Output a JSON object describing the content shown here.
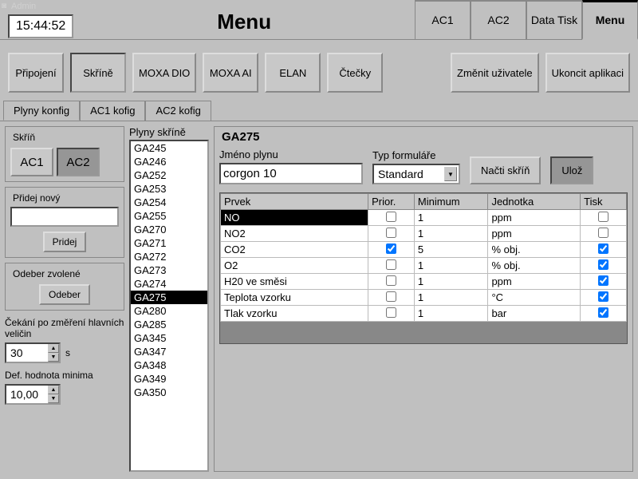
{
  "header": {
    "admin_label": "Admin",
    "time": "15:44:52",
    "title": "Menu",
    "tabs": [
      "AC1",
      "AC2",
      "Data Tisk",
      "Menu"
    ]
  },
  "toolbar": {
    "buttons": [
      "Připojení",
      "Skříně",
      "MOXA DIO",
      "MOXA AI",
      "ELAN",
      "Čtečky"
    ],
    "change_user": "Změnit uživatele",
    "exit_app": "Ukoncit aplikaci"
  },
  "tabs": {
    "items": [
      "Plyny konfig",
      "AC1 kofig",
      "AC2 kofig"
    ]
  },
  "left": {
    "skrin_label": "Skříň",
    "ac1": "AC1",
    "ac2": "AC2",
    "pridej_novy_label": "Přidej nový",
    "pridej_value": "",
    "pridej_btn": "Pridej",
    "odeber_label": "Odeber zvolené",
    "odeber_btn": "Odeber",
    "cekani_label": "Čekání po změření hlavních veličin",
    "cekani_val": "30",
    "cekani_unit": "s",
    "def_min_label": "Def. hodnota minima",
    "def_min_val": "10,00"
  },
  "list": {
    "label": "Plyny skříně",
    "items": [
      "GA245",
      "GA246",
      "GA252",
      "GA253",
      "GA254",
      "GA255",
      "GA270",
      "GA271",
      "GA272",
      "GA273",
      "GA274",
      "GA275",
      "GA280",
      "GA285",
      "GA345",
      "GA347",
      "GA348",
      "GA349",
      "GA350"
    ],
    "selected": "GA275"
  },
  "main": {
    "title": "GA275",
    "jmeno_label": "Jméno plynu",
    "jmeno_val": "corgon 10",
    "typ_label": "Typ formuláře",
    "typ_val": "Standard",
    "nacti_btn": "Načti skříň",
    "uloz_btn": "Ulož",
    "cols": {
      "prvek": "Prvek",
      "prior": "Prior.",
      "min": "Minimum",
      "jedn": "Jednotka",
      "tisk": "Tisk"
    },
    "rows": [
      {
        "prvek": "NO",
        "prior": false,
        "min": "1",
        "jedn": "ppm",
        "tisk": false,
        "sel": true
      },
      {
        "prvek": "NO2",
        "prior": false,
        "min": "1",
        "jedn": "ppm",
        "tisk": false
      },
      {
        "prvek": "CO2",
        "prior": true,
        "min": "5",
        "jedn": "% obj.",
        "tisk": true
      },
      {
        "prvek": "O2",
        "prior": false,
        "min": "1",
        "jedn": "% obj.",
        "tisk": true
      },
      {
        "prvek": "H20 ve směsi",
        "prior": false,
        "min": "1",
        "jedn": "ppm",
        "tisk": true
      },
      {
        "prvek": "Teplota vzorku",
        "prior": false,
        "min": "1",
        "jedn": "°C",
        "tisk": true
      },
      {
        "prvek": "Tlak vzorku",
        "prior": false,
        "min": "1",
        "jedn": "bar",
        "tisk": true
      }
    ]
  }
}
